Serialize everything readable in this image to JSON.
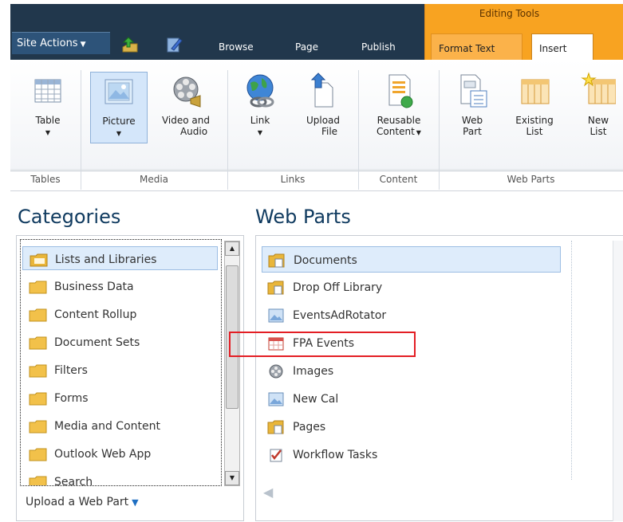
{
  "top": {
    "contextual_title": "Editing Tools",
    "site_actions": "Site Actions",
    "tabs": [
      "Browse",
      "Page",
      "Publish"
    ],
    "context_tabs": [
      "Format Text",
      "Insert"
    ]
  },
  "ribbon": {
    "buttons": [
      {
        "label_line1": "Table",
        "label_line2": "",
        "dropdown": true
      },
      {
        "label_line1": "Picture",
        "label_line2": "",
        "dropdown": true
      },
      {
        "label_line1": "Video and",
        "label_line2": "Audio",
        "dropdown": false
      },
      {
        "label_line1": "Link",
        "label_line2": "",
        "dropdown": true
      },
      {
        "label_line1": "Upload",
        "label_line2": "File",
        "dropdown": false
      },
      {
        "label_line1": "Reusable",
        "label_line2": "Content",
        "dropdown": true
      },
      {
        "label_line1": "Web",
        "label_line2": "Part",
        "dropdown": false
      },
      {
        "label_line1": "Existing",
        "label_line2": "List",
        "dropdown": false
      },
      {
        "label_line1": "New",
        "label_line2": "List",
        "dropdown": false
      }
    ],
    "groups": [
      "Tables",
      "Media",
      "Links",
      "Content",
      "Web Parts"
    ]
  },
  "categories": {
    "title": "Categories",
    "items": [
      "Lists and Libraries",
      "Business Data",
      "Content Rollup",
      "Document Sets",
      "Filters",
      "Forms",
      "Media and Content",
      "Outlook Web App",
      "Search"
    ],
    "upload_label": "Upload a Web Part"
  },
  "webparts": {
    "title": "Web Parts",
    "items": [
      {
        "label": "Documents",
        "icon": "library-icon"
      },
      {
        "label": "Drop Off Library",
        "icon": "library-icon"
      },
      {
        "label": "EventsAdRotator",
        "icon": "picture-icon"
      },
      {
        "label": "FPA Events",
        "icon": "calendar-icon"
      },
      {
        "label": "Images",
        "icon": "film-reel-icon"
      },
      {
        "label": "New Cal",
        "icon": "picture-icon"
      },
      {
        "label": "Pages",
        "icon": "library-icon"
      },
      {
        "label": "Workflow Tasks",
        "icon": "task-icon"
      }
    ]
  },
  "colors": {
    "header_dark": "#21374c",
    "contextual_orange": "#f8a321",
    "selection_blue": "#deecfb",
    "highlight_red": "#e31e24",
    "heading_blue": "#0f3a5f"
  }
}
